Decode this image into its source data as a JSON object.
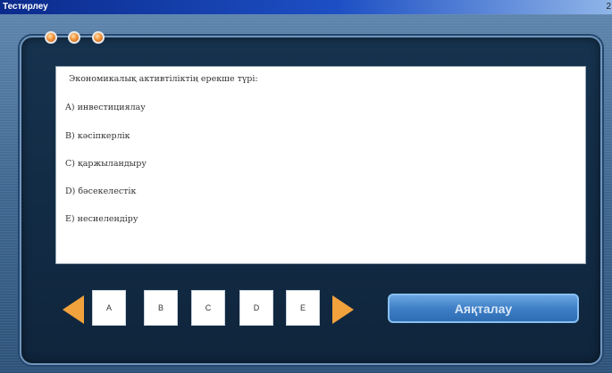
{
  "window": {
    "title": "Тестирлеу",
    "corner_number": "2"
  },
  "question": {
    "text": "Экономикалық активтіліктің ерекше түрі:",
    "options": [
      {
        "text": "A) инвестициялау"
      },
      {
        "text": "B) кәсіпкерлік"
      },
      {
        "text": "C) қаржыландыру"
      },
      {
        "text": "D) бәсекелестік"
      },
      {
        "text": "E) несиелендіру"
      }
    ]
  },
  "nav": {
    "buttons": [
      "A",
      "B",
      "C",
      "D",
      "E"
    ],
    "finish_label": "Аяқталау"
  },
  "colors": {
    "accent_orange": "#f2a23c",
    "panel": "#16324e",
    "button_blue": "#3f7fc6"
  }
}
